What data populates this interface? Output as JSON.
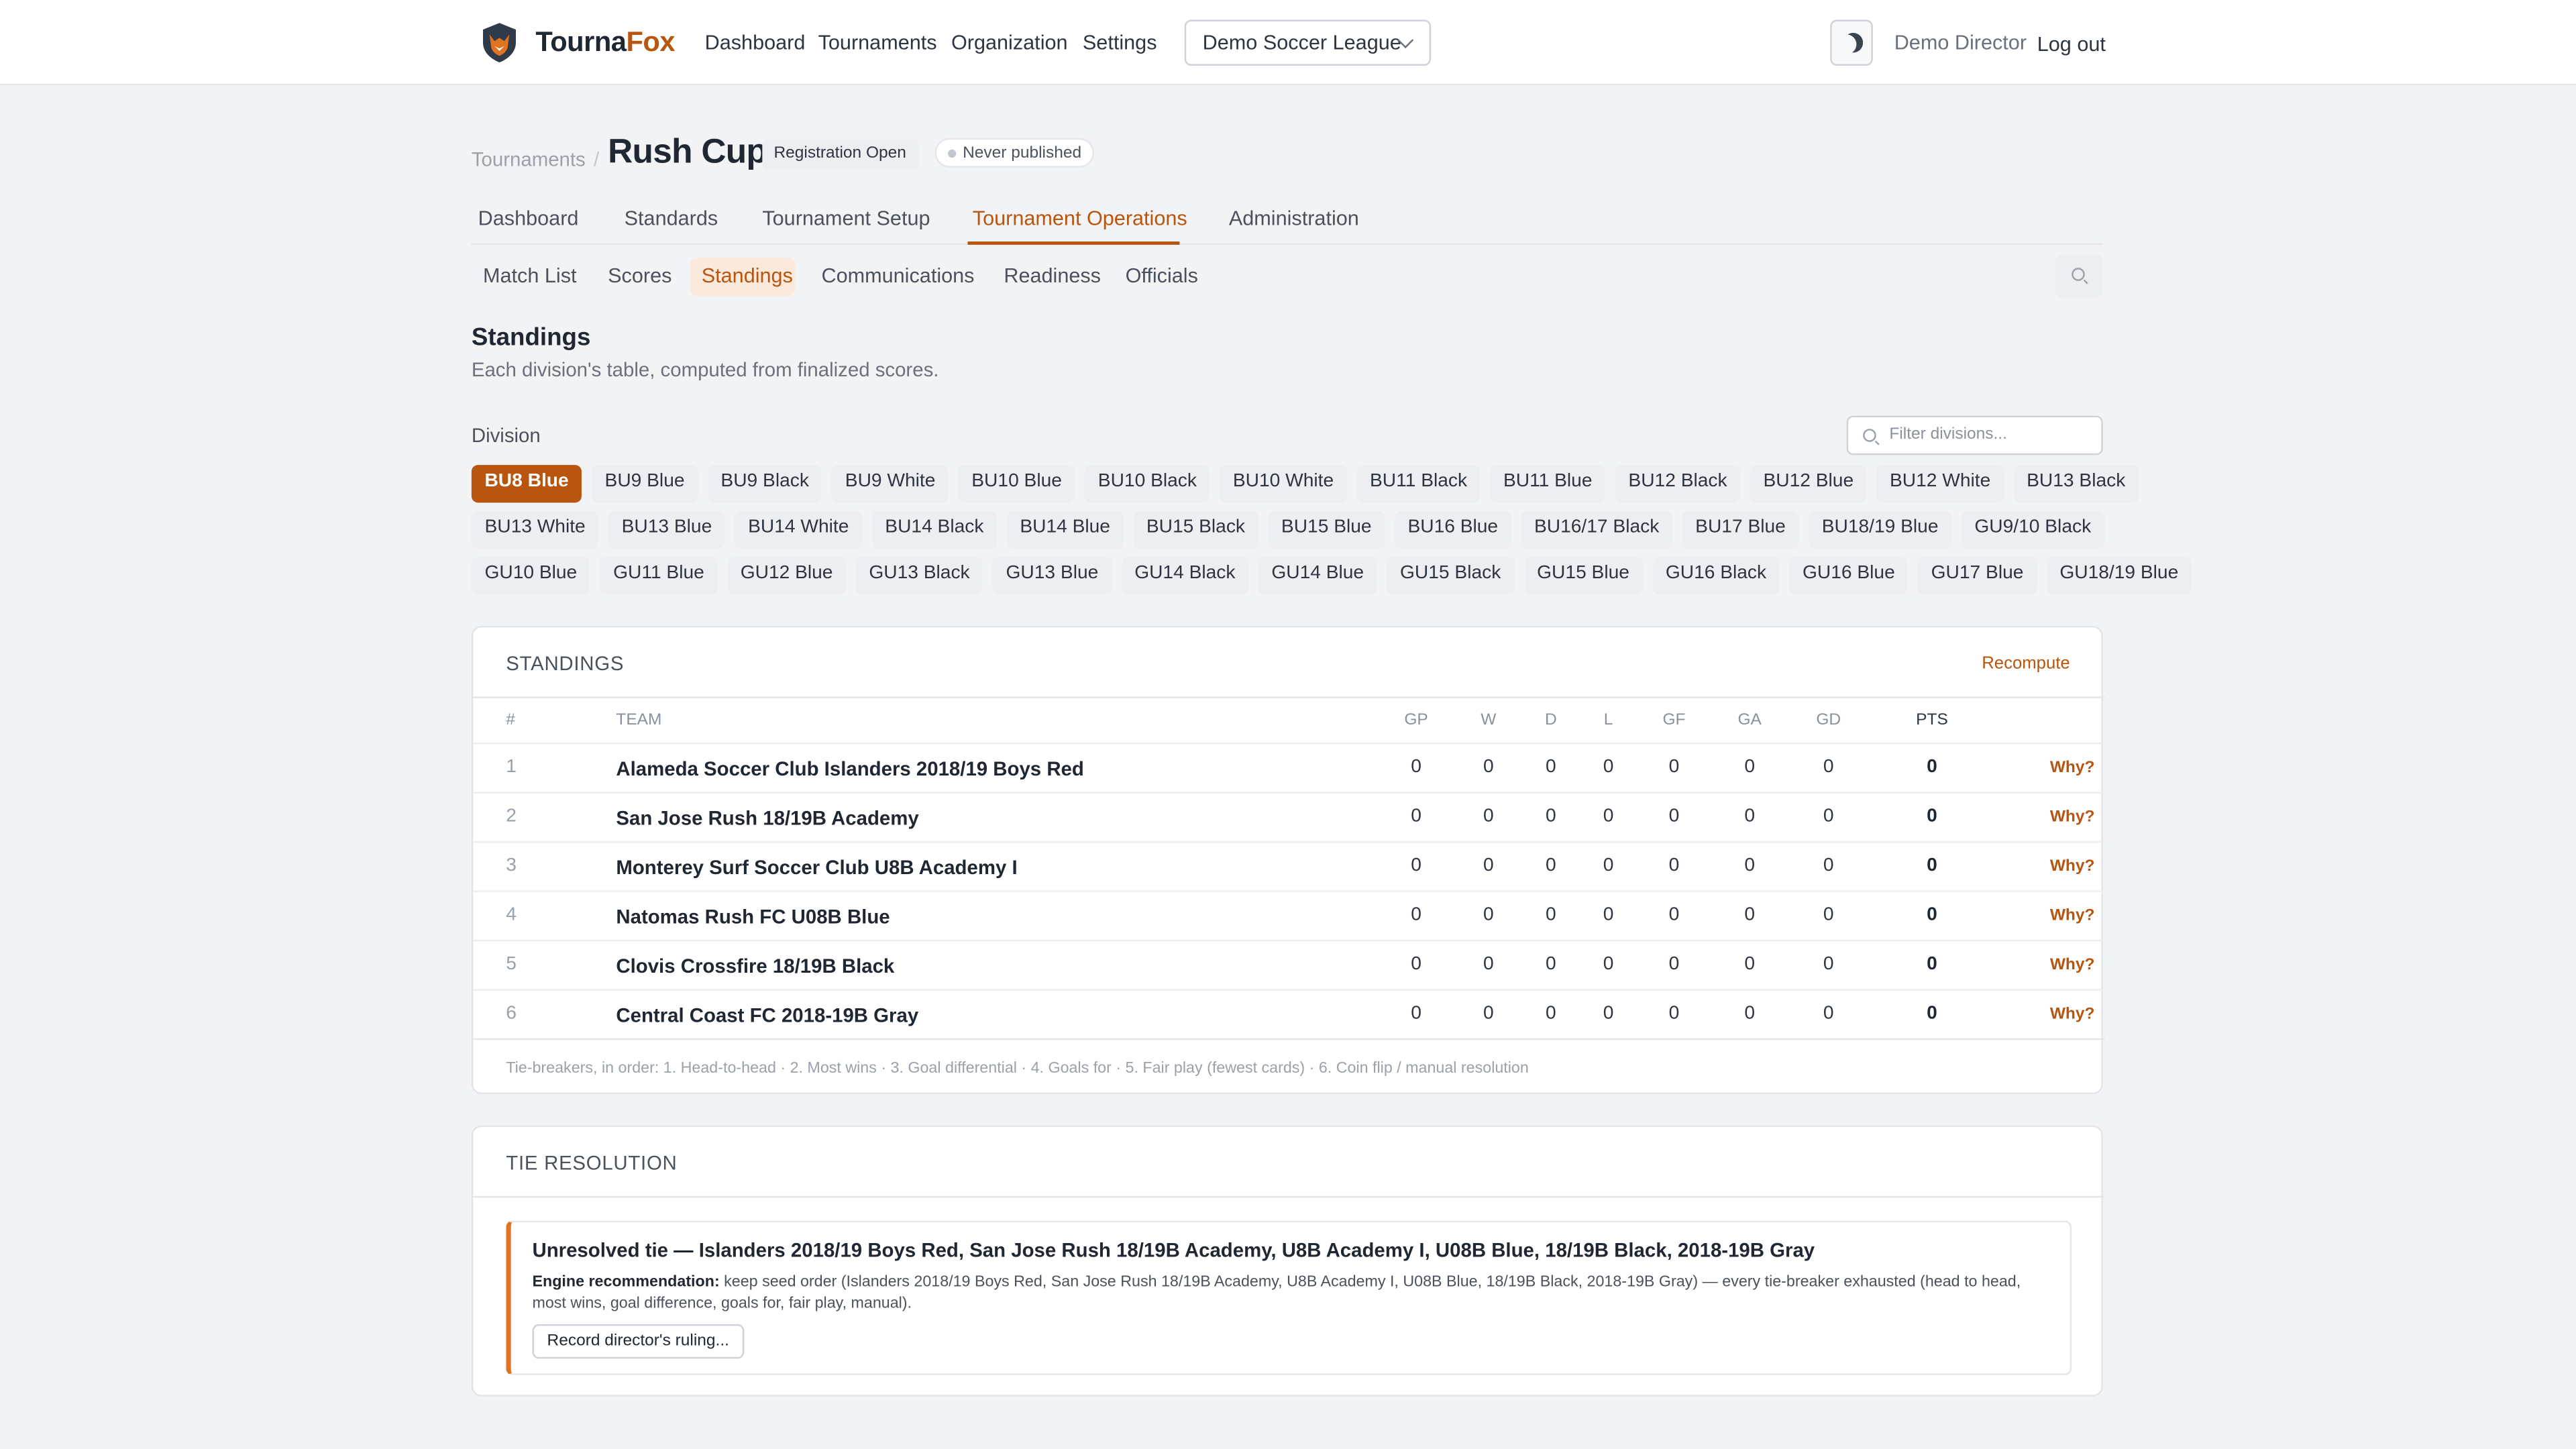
{
  "header": {
    "brand_part1": "Tourna",
    "brand_part2": "Fox",
    "nav": [
      "Dashboard",
      "Tournaments",
      "Organization",
      "Settings"
    ],
    "org_selected": "Demo Soccer League",
    "user": "Demo Director",
    "logout": "Log out",
    "icons": [
      "fox-logo-icon",
      "chevron-down-icon",
      "moon-icon"
    ]
  },
  "breadcrumb": {
    "parent": "Tournaments",
    "sep": "/"
  },
  "tournament": {
    "name": "Rush Cup",
    "status_badge": "Registration Open",
    "publish_badge": "Never published"
  },
  "tabs": [
    "Dashboard",
    "Standards",
    "Tournament Setup",
    "Tournament Operations",
    "Administration"
  ],
  "active_tab": "Tournament Operations",
  "subtabs": [
    "Match List",
    "Scores",
    "Standings",
    "Communications",
    "Readiness",
    "Officials"
  ],
  "active_subtab": "Standings",
  "section": {
    "title": "Standings",
    "subtitle": "Each division's table, computed from finalized scores.",
    "division_label": "Division",
    "filter_placeholder": "Filter divisions..."
  },
  "divisions": [
    [
      "BU8 Blue",
      "BU9 Blue",
      "BU9 Black",
      "BU9 White",
      "BU10 Blue",
      "BU10 Black",
      "BU10 White",
      "BU11 Black",
      "BU11 Blue",
      "BU12 Black",
      "BU12 Blue",
      "BU12 White",
      "BU13 Black"
    ],
    [
      "BU13 White",
      "BU13 Blue",
      "BU14 White",
      "BU14 Black",
      "BU14 Blue",
      "BU15 Black",
      "BU15 Blue",
      "BU16 Blue",
      "BU16/17 Black",
      "BU17 Blue",
      "BU18/19 Blue",
      "GU9/10 Black"
    ],
    [
      "GU10 Blue",
      "GU11 Blue",
      "GU12 Blue",
      "GU13 Black",
      "GU13 Blue",
      "GU14 Black",
      "GU14 Blue",
      "GU15 Black",
      "GU15 Blue",
      "GU16 Black",
      "GU16 Blue",
      "GU17 Blue",
      "GU18/19 Blue"
    ]
  ],
  "active_division": "BU8 Blue",
  "standings": {
    "heading": "STANDINGS",
    "recompute": "Recompute",
    "columns": [
      "#",
      "TEAM",
      "GP",
      "W",
      "D",
      "L",
      "GF",
      "GA",
      "GD",
      "PTS"
    ],
    "why_label": "Why?",
    "rows": [
      {
        "rank": "1",
        "team": "Alameda Soccer Club Islanders 2018/19 Boys Red",
        "gp": "0",
        "w": "0",
        "d": "0",
        "l": "0",
        "gf": "0",
        "ga": "0",
        "gd": "0",
        "pts": "0"
      },
      {
        "rank": "2",
        "team": "San Jose Rush 18/19B Academy",
        "gp": "0",
        "w": "0",
        "d": "0",
        "l": "0",
        "gf": "0",
        "ga": "0",
        "gd": "0",
        "pts": "0"
      },
      {
        "rank": "3",
        "team": "Monterey Surf Soccer Club U8B Academy I",
        "gp": "0",
        "w": "0",
        "d": "0",
        "l": "0",
        "gf": "0",
        "ga": "0",
        "gd": "0",
        "pts": "0"
      },
      {
        "rank": "4",
        "team": "Natomas Rush FC U08B Blue",
        "gp": "0",
        "w": "0",
        "d": "0",
        "l": "0",
        "gf": "0",
        "ga": "0",
        "gd": "0",
        "pts": "0"
      },
      {
        "rank": "5",
        "team": "Clovis Crossfire 18/19B Black",
        "gp": "0",
        "w": "0",
        "d": "0",
        "l": "0",
        "gf": "0",
        "ga": "0",
        "gd": "0",
        "pts": "0"
      },
      {
        "rank": "6",
        "team": "Central Coast FC 2018-19B Gray",
        "gp": "0",
        "w": "0",
        "d": "0",
        "l": "0",
        "gf": "0",
        "ga": "0",
        "gd": "0",
        "pts": "0"
      }
    ],
    "tiebreak_note": "Tie-breakers, in order: 1. Head-to-head · 2. Most wins · 3. Goal differential · 4. Goals for · 5. Fair play (fewest cards) · 6. Coin flip / manual resolution"
  },
  "tie_resolution": {
    "heading": "TIE RESOLUTION",
    "title": "Unresolved tie — Islanders 2018/19 Boys Red, San Jose Rush 18/19B Academy, U8B Academy I, U08B Blue, 18/19B Black, 2018-19B Gray",
    "rec_label": "Engine recommendation:",
    "rec_text": " keep seed order (Islanders 2018/19 Boys Red, San Jose Rush 18/19B Academy, U8B Academy I, U08B Blue, 18/19B Black, 2018-19B Gray) — every tie-breaker exhausted (head to head, most wins, goal difference, goals for, fair play, manual).",
    "button": "Record director's ruling..."
  },
  "colors": {
    "accent": "#b8550e",
    "tie_border": "#e0731f",
    "background": "#f2f3f5"
  }
}
